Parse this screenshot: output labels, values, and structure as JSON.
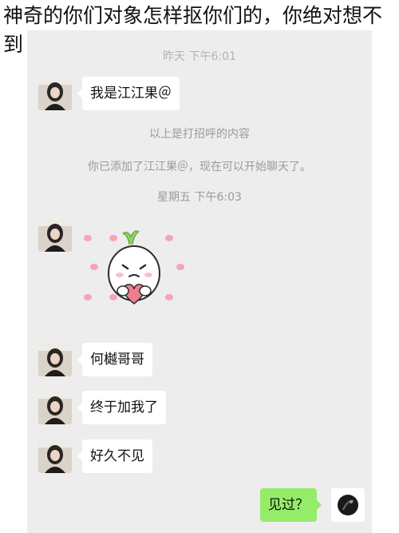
{
  "caption": "神奇的你们对象怎样抠你们的，你绝对想不到",
  "chat": {
    "timestamp_top": "昨天 下午6:01",
    "messages_first": "我是江江果＠",
    "system_greeting": "以上是打招呼的内容",
    "system_added": "你已添加了江江果＠，现在可以开始聊天了。",
    "timestamp_second": "星期五 下午6:03",
    "msg_name": "何樾哥哥",
    "msg_finally": "终于加我了",
    "msg_long_time": "好久不见",
    "my_reply": "见过？"
  },
  "colors": {
    "chat_bg": "#ededed",
    "their_bubble": "#ffffff",
    "my_bubble": "#95ec69"
  },
  "icons": {
    "sticker": "heart-hug-sticker",
    "avatar_contact": "contact-avatar",
    "avatar_me": "my-avatar"
  }
}
